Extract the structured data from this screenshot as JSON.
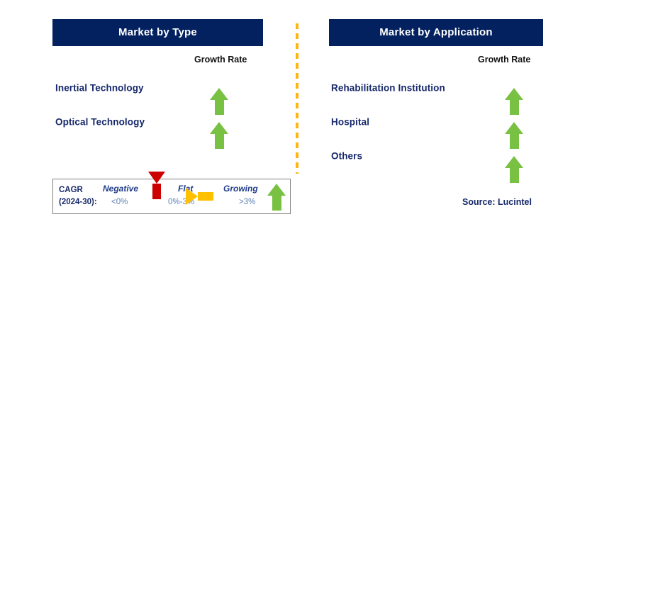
{
  "panels": [
    {
      "id": "type",
      "title": "Market by Type",
      "growth_rate_label": "Growth Rate",
      "rows": [
        {
          "label": "Inertial Technology",
          "growth": "growing",
          "icon": "arrow-up-icon"
        },
        {
          "label": "Optical Technology",
          "growth": "growing",
          "icon": "arrow-up-icon"
        }
      ]
    },
    {
      "id": "application",
      "title": "Market by Application",
      "growth_rate_label": "Growth Rate",
      "rows": [
        {
          "label": "Rehabilitation Institution",
          "growth": "growing",
          "icon": "arrow-up-icon"
        },
        {
          "label": "Hospital",
          "growth": "growing",
          "icon": "arrow-up-icon"
        },
        {
          "label": "Others",
          "growth": "growing",
          "icon": "arrow-up-icon"
        }
      ]
    }
  ],
  "legend": {
    "cagr_line1": "CAGR",
    "cagr_line2": "(2024-30):",
    "items": [
      {
        "title": "Negative",
        "range": "<0%",
        "icon": "arrow-down-icon",
        "color": "#CC0000"
      },
      {
        "title": "Flat",
        "range": "0%-3%",
        "icon": "arrow-right-icon",
        "color": "#FFC000"
      },
      {
        "title": "Growing",
        "range": ">3%",
        "icon": "arrow-up-icon",
        "color": "#79C143"
      }
    ]
  },
  "source": "Source: Lucintel",
  "colors": {
    "header_bg": "#03215F",
    "header_text": "#FFFFFF",
    "label_navy": "#17296B",
    "growing_green": "#79C143",
    "negative_red": "#CC0000",
    "flat_orange": "#FFC000",
    "divider_orange": "#FFB511",
    "legend_border": "#7F7F7F",
    "legend_range_text": "#5B7FB5"
  }
}
